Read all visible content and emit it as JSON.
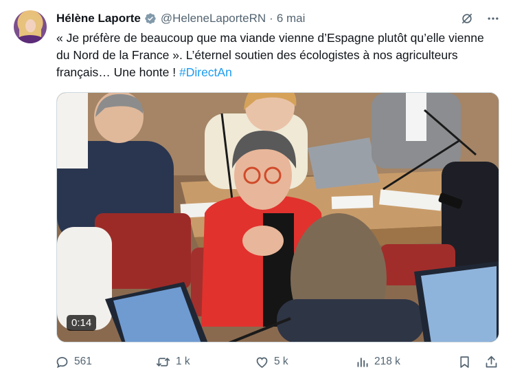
{
  "author": {
    "name": "Hélène Laporte",
    "handle": "@HeleneLaporteRN",
    "separator": "·",
    "time": "6 mai",
    "verified": true
  },
  "tweet": {
    "text": "« Je préfère de beaucoup que ma viande vienne d’Espagne plutôt qu’elle vienne du Nord de la France ». L’éternel soutien des écologistes à nos agriculteurs français… Une honte ! ",
    "hashtag": "#DirectAn"
  },
  "media": {
    "type": "video",
    "duration": "0:14"
  },
  "actions": {
    "replies": "561",
    "reposts": "1 k",
    "likes": "5 k",
    "views": "218 k"
  },
  "colors": {
    "link": "#1d9bf0",
    "secondary_text": "#536471",
    "verified_badge": "#829aab"
  },
  "icons": [
    "grok-icon",
    "more-icon",
    "reply-icon",
    "retweet-icon",
    "like-icon",
    "views-icon",
    "bookmark-icon",
    "share-icon"
  ]
}
